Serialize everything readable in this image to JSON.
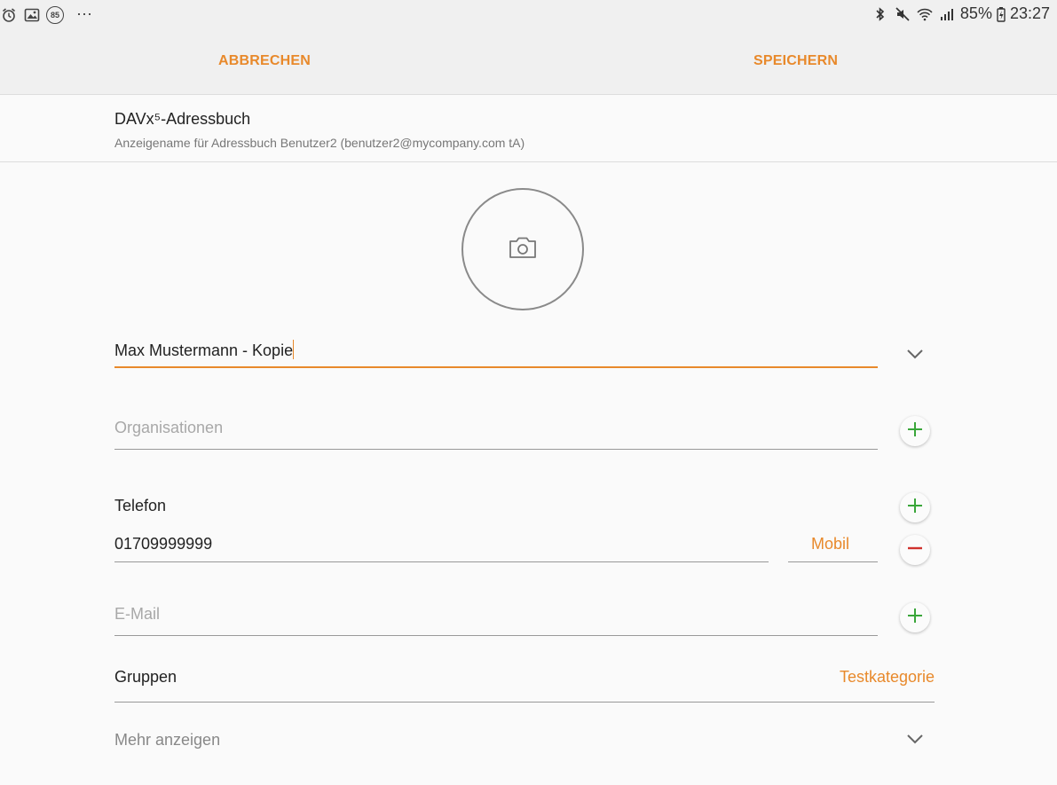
{
  "status_bar": {
    "notification_badge": "85",
    "overflow": "⋯",
    "battery": "85%",
    "time": "23:27",
    "icons": [
      "alarm-icon",
      "gallery-icon",
      "badge-85-icon",
      "bluetooth-icon",
      "mute-icon",
      "wifi-icon",
      "signal-icon",
      "battery-charging-icon"
    ]
  },
  "action_bar": {
    "cancel_label": "ABBRECHEN",
    "save_label": "SPEICHERN"
  },
  "account": {
    "title": "DAVx⁵-Adressbuch",
    "subtitle": "Anzeigename für Adressbuch Benutzer2 (benutzer2@mycompany.com tA)"
  },
  "photo": {
    "icon": "camera-icon"
  },
  "name": {
    "value": "Max Mustermann - Kopie"
  },
  "organization": {
    "placeholder": "Organisationen"
  },
  "phone": {
    "section_label": "Telefon",
    "number": "01709999999",
    "type": "Mobil"
  },
  "email": {
    "placeholder": "E-Mail"
  },
  "groups": {
    "label": "Gruppen",
    "value": "Testkategorie"
  },
  "more": {
    "label": "Mehr anzeigen"
  },
  "colors": {
    "accent": "#e8892b",
    "add": "#3aa63a",
    "remove": "#d0312d"
  }
}
